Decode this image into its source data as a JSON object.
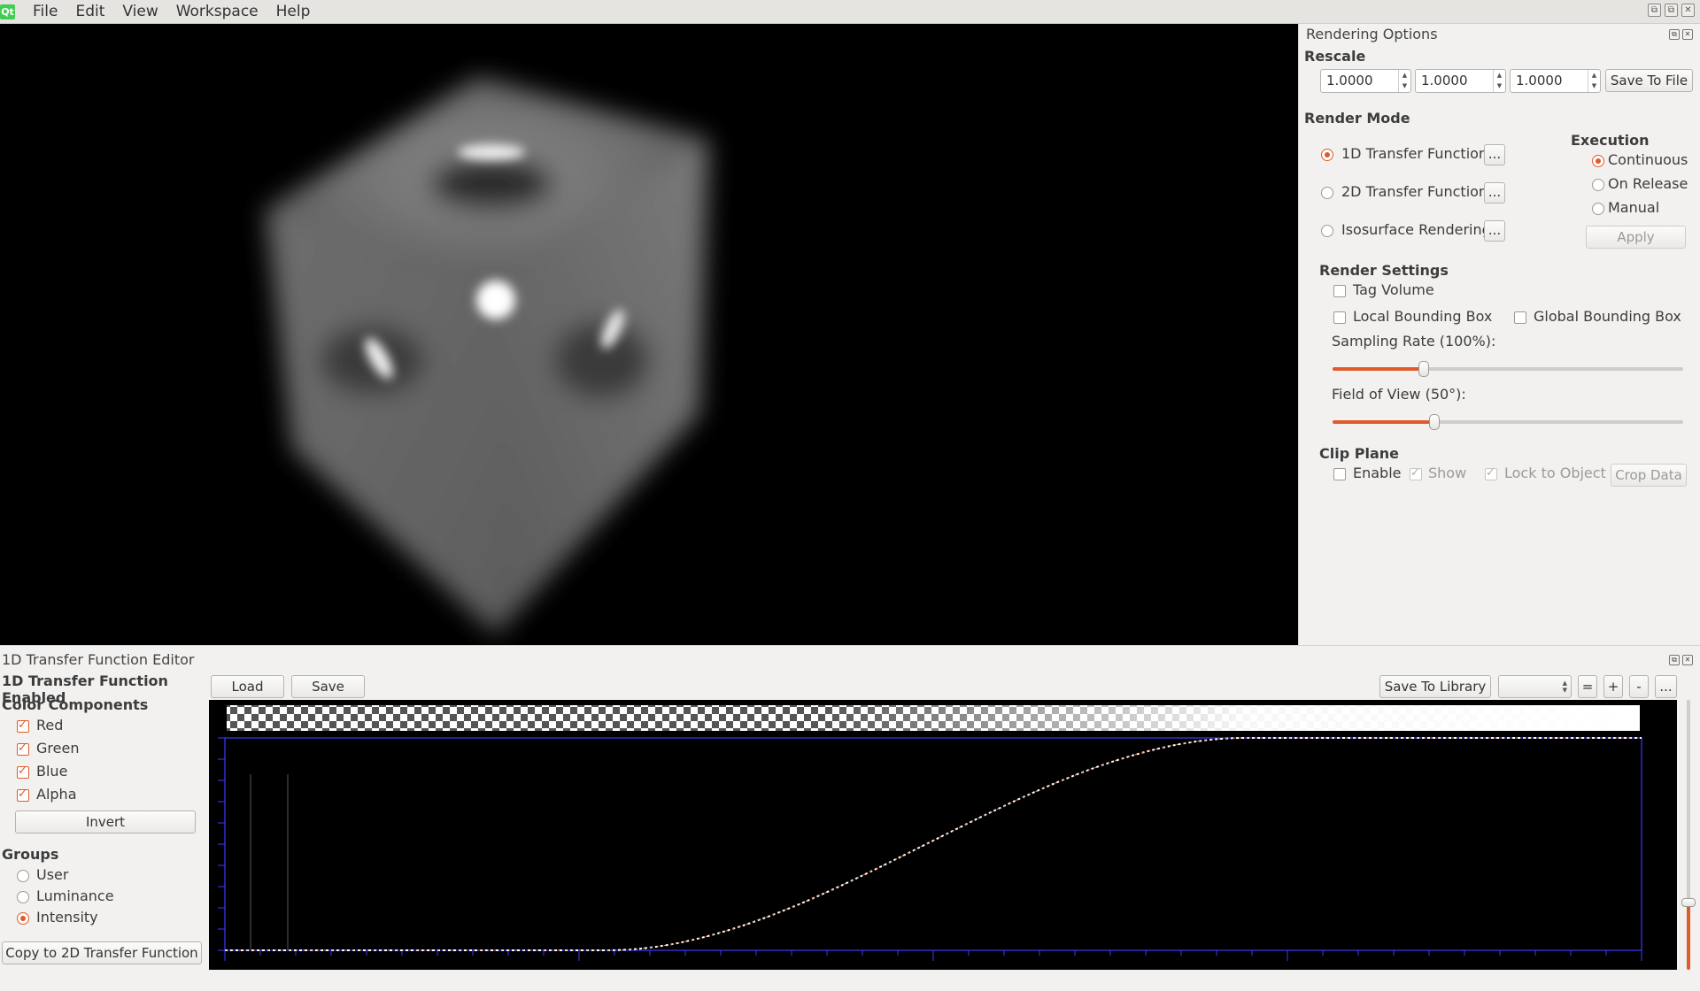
{
  "menu": {
    "logo": "Qt",
    "items": [
      "File",
      "Edit",
      "View",
      "Workspace",
      "Help"
    ]
  },
  "window_controls": [
    "⧉",
    "⧉",
    "✕"
  ],
  "rendering_options": {
    "title": "Rendering Options",
    "rescale": {
      "title": "Rescale",
      "values": [
        "1.0000",
        "1.0000",
        "1.0000"
      ],
      "save_to_file": "Save To File"
    },
    "render_mode": {
      "title": "Render Mode",
      "modes": [
        {
          "label": "1D Transfer Function",
          "selected": true
        },
        {
          "label": "2D Transfer Function",
          "selected": false
        },
        {
          "label": "Isosurface Rendering",
          "selected": false
        }
      ],
      "more_label": "..."
    },
    "execution": {
      "title": "Execution",
      "options": [
        {
          "label": "Continuous",
          "selected": true
        },
        {
          "label": "On Release",
          "selected": false
        },
        {
          "label": "Manual",
          "selected": false
        }
      ],
      "apply": "Apply"
    },
    "render_settings": {
      "title": "Render Settings",
      "tag_volume": "Tag Volume",
      "local_bbox": "Local Bounding Box",
      "global_bbox": "Global Bounding Box",
      "sampling_rate_label": "Sampling Rate (100%):",
      "sampling_rate_fraction": 0.26,
      "fov_label": "Field of View (50°):",
      "fov_fraction": 0.29
    },
    "clip_plane": {
      "title": "Clip Plane",
      "enable": "Enable",
      "show": "Show",
      "lock_to_object": "Lock to Object",
      "crop_data": "Crop Data"
    }
  },
  "tf_editor": {
    "title": "1D Transfer Function Editor",
    "enabled_label": "1D Transfer Function Enabled",
    "color_components_title": "Color Components",
    "components": [
      {
        "label": "Red",
        "checked": true
      },
      {
        "label": "Green",
        "checked": true
      },
      {
        "label": "Blue",
        "checked": true
      },
      {
        "label": "Alpha",
        "checked": true
      }
    ],
    "invert": "Invert",
    "groups_title": "Groups",
    "groups": [
      {
        "label": "User",
        "selected": false
      },
      {
        "label": "Luminance",
        "selected": false
      },
      {
        "label": "Intensity",
        "selected": true
      }
    ],
    "copy_to_2d": "Copy to 2D Transfer Function",
    "toolbar": {
      "load": "Load",
      "save": "Save",
      "save_to_library": "Save To Library",
      "equal": "=",
      "plus": "+",
      "minus": "-",
      "more": "..."
    },
    "opacity_slider_fraction": 0.75
  },
  "colors": {
    "accent": "#e05a2a",
    "curve_frame": "#3a3aff"
  }
}
